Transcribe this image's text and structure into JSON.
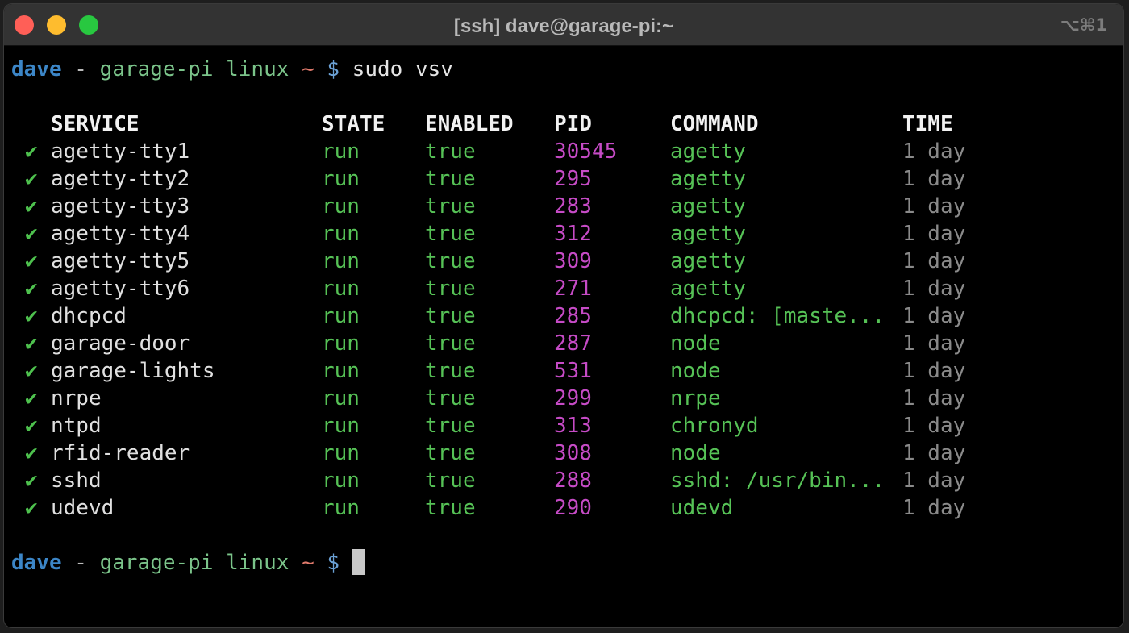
{
  "window": {
    "title": "[ssh] dave@garage-pi:~",
    "shortcut": "⌥⌘1"
  },
  "prompt": {
    "user": "dave",
    "separator": "-",
    "host": "garage-pi linux",
    "dir": "~",
    "symbol": "$"
  },
  "command": "sudo vsv",
  "table": {
    "headers": {
      "service": "SERVICE",
      "state": "STATE",
      "enabled": "ENABLED",
      "pid": "PID",
      "command": "COMMAND",
      "time": "TIME"
    },
    "check_glyph": "✔",
    "rows": [
      {
        "service": "agetty-tty1",
        "state": "run",
        "enabled": "true",
        "pid": "30545",
        "command": "agetty",
        "time": "1 day"
      },
      {
        "service": "agetty-tty2",
        "state": "run",
        "enabled": "true",
        "pid": "295",
        "command": "agetty",
        "time": "1 day"
      },
      {
        "service": "agetty-tty3",
        "state": "run",
        "enabled": "true",
        "pid": "283",
        "command": "agetty",
        "time": "1 day"
      },
      {
        "service": "agetty-tty4",
        "state": "run",
        "enabled": "true",
        "pid": "312",
        "command": "agetty",
        "time": "1 day"
      },
      {
        "service": "agetty-tty5",
        "state": "run",
        "enabled": "true",
        "pid": "309",
        "command": "agetty",
        "time": "1 day"
      },
      {
        "service": "agetty-tty6",
        "state": "run",
        "enabled": "true",
        "pid": "271",
        "command": "agetty",
        "time": "1 day"
      },
      {
        "service": "dhcpcd",
        "state": "run",
        "enabled": "true",
        "pid": "285",
        "command": "dhcpcd: [maste...",
        "time": "1 day"
      },
      {
        "service": "garage-door",
        "state": "run",
        "enabled": "true",
        "pid": "287",
        "command": "node",
        "time": "1 day"
      },
      {
        "service": "garage-lights",
        "state": "run",
        "enabled": "true",
        "pid": "531",
        "command": "node",
        "time": "1 day"
      },
      {
        "service": "nrpe",
        "state": "run",
        "enabled": "true",
        "pid": "299",
        "command": "nrpe",
        "time": "1 day"
      },
      {
        "service": "ntpd",
        "state": "run",
        "enabled": "true",
        "pid": "313",
        "command": "chronyd",
        "time": "1 day"
      },
      {
        "service": "rfid-reader",
        "state": "run",
        "enabled": "true",
        "pid": "308",
        "command": "node",
        "time": "1 day"
      },
      {
        "service": "sshd",
        "state": "run",
        "enabled": "true",
        "pid": "288",
        "command": "sshd: /usr/bin...",
        "time": "1 day"
      },
      {
        "service": "udevd",
        "state": "run",
        "enabled": "true",
        "pid": "290",
        "command": "udevd",
        "time": "1 day"
      }
    ]
  },
  "colors": {
    "user": "#3c86c7",
    "host": "#7bc48a",
    "tilde": "#e07a6c",
    "ok": "#56c256",
    "pid": "#c64bc6",
    "time": "#8a8a8a"
  }
}
